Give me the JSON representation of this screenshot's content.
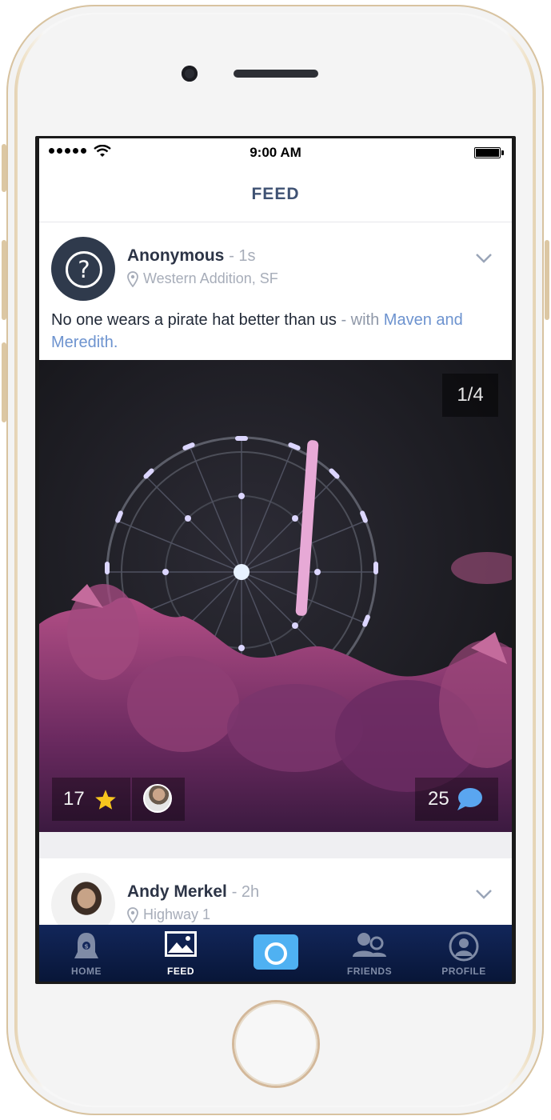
{
  "status_bar": {
    "time": "9:00 AM"
  },
  "header": {
    "title": "FEED"
  },
  "posts": [
    {
      "author": "Anonymous",
      "time_ago": "- 1s",
      "location": "Western Addition, SF",
      "text": "No one wears a pirate hat better than us",
      "with_prefix": " - with",
      "with_people": "Maven and Meredith.",
      "photo_counter": "1/4",
      "stars": "17",
      "comments": "25"
    },
    {
      "author": "Andy Merkel",
      "time_ago": "- 2h",
      "location": "Highway 1"
    }
  ],
  "tabs": [
    {
      "label": "HOME",
      "icon": "home-ghost-icon"
    },
    {
      "label": "FEED",
      "icon": "image-icon"
    },
    {
      "label": "",
      "icon": "camera-icon"
    },
    {
      "label": "FRIENDS",
      "icon": "friends-icon"
    },
    {
      "label": "PROFILE",
      "icon": "profile-icon"
    }
  ],
  "colors": {
    "tabbar": "#0c1d48",
    "camera_button": "#4fb1f2",
    "link": "#6d93cf",
    "star": "#f7c51e",
    "comment_bubble": "#5aa6f0"
  }
}
